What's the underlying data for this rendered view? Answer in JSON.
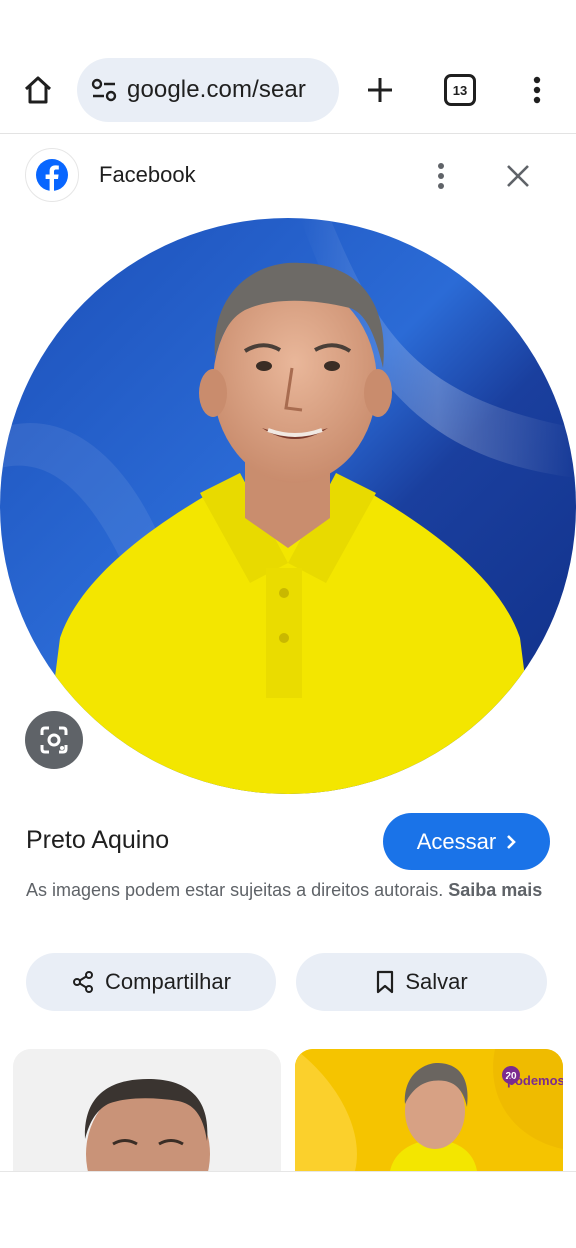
{
  "browser": {
    "url": "google.com/sear",
    "tab_count": "13",
    "icons": {
      "home": "home-icon",
      "site_info": "tune-icon",
      "new_tab": "plus-icon",
      "menu": "more-vert-icon"
    }
  },
  "viewer": {
    "source_name": "Facebook",
    "source_icon": "facebook-logo",
    "icons": {
      "more": "more-vert-icon",
      "close": "close-icon",
      "lens": "lens-icon"
    }
  },
  "result": {
    "title": "Preto Aquino",
    "visit_label": "Acessar",
    "notice_text": "As imagens podem estar sujeitas a direitos autorais.",
    "learn_more": "Saiba mais",
    "share_label": "Compartilhar",
    "save_label": "Salvar"
  },
  "related": [
    {
      "kind": "photo"
    },
    {
      "kind": "campaign-banner",
      "badge": "podemos",
      "badge_number": "20"
    }
  ],
  "colors": {
    "accent": "#1a73e8",
    "pill_bg": "#e9eef6",
    "shirt": "#f3e600",
    "flag_blue": "#1f4fb5"
  }
}
